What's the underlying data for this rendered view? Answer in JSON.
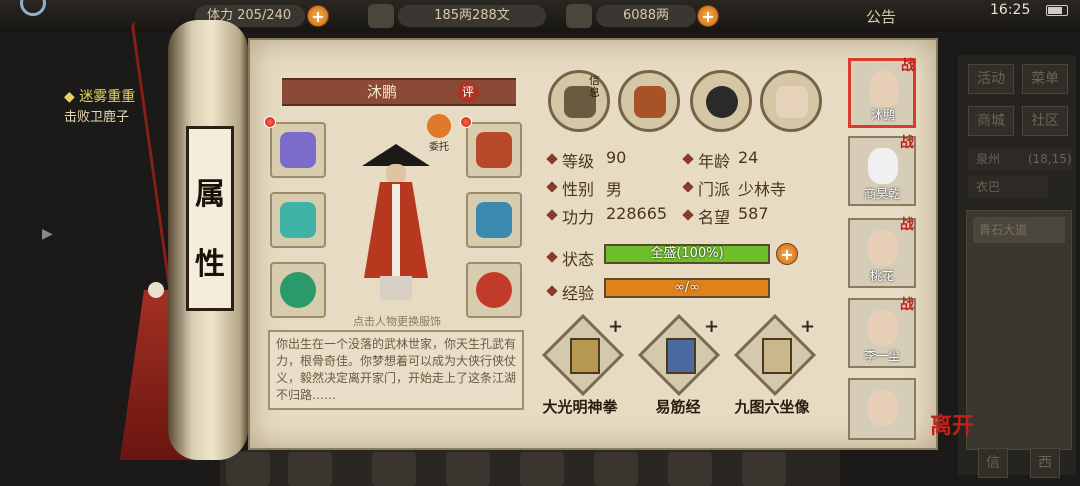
{
  "topbar": {
    "stat1": "体力 205/240",
    "coins": "185两288文",
    "gold": "6088两",
    "notice": "公告",
    "time": "16:25"
  },
  "quest": {
    "title": "◆ 迷雾重重",
    "desc": "击败卫鹿子"
  },
  "scroll": {
    "c1": "属",
    "c2": "性"
  },
  "character": {
    "name": "沐鹏",
    "rate_badge": "评",
    "entrust": "委托",
    "hint": "点击人物更换服饰",
    "description": "你出生在一个没落的武林世家，你天生孔武有力，根骨奇佳。你梦想着可以成为大侠行侠仗义，毅然决定离开家门，开始走上了这条江湖不归路……"
  },
  "top_icons": [
    {
      "name": "info-icon",
      "tag": "信息"
    },
    {
      "name": "scroll-icon",
      "tag": ""
    },
    {
      "name": "bagua-icon",
      "tag": ""
    },
    {
      "name": "meridian-icon",
      "tag": ""
    }
  ],
  "stats": {
    "level_k": "等级",
    "level_v": "90",
    "age_k": "年龄",
    "age_v": "24",
    "gender_k": "性别",
    "gender_v": "男",
    "sect_k": "门派",
    "sect_v": "少林寺",
    "power_k": "功力",
    "power_v": "228665",
    "fame_k": "名望",
    "fame_v": "587",
    "state_k": "状态",
    "state_v": "全盛(100%)",
    "state_fraction": 1.0,
    "exp_k": "经验",
    "exp_v": "∞/∞",
    "exp_fraction": 1.0
  },
  "skills": [
    {
      "name": "大光明神拳"
    },
    {
      "name": "易筋经"
    },
    {
      "name": "九图六坐像"
    }
  ],
  "party": [
    {
      "name": "沐鹏",
      "tag": "战",
      "selected": true
    },
    {
      "name": "商昊乾",
      "tag": "战"
    },
    {
      "name": "桃花",
      "tag": "战"
    },
    {
      "name": "李一尘",
      "tag": "战"
    },
    {
      "name": "",
      "tag": ""
    }
  ],
  "leave": "离开",
  "right_menu": {
    "b1": "活动",
    "b2": "菜单",
    "b3": "商城",
    "b4": "社区",
    "location": "泉州",
    "coords": "(18,15)",
    "tab": "衣巴",
    "list_item": "青石大道",
    "b5": "信",
    "b6": "西"
  },
  "colors": {
    "state_bar": "#6fbf2a",
    "exp_bar": "#e0821a",
    "accent_red": "#c0221a"
  }
}
